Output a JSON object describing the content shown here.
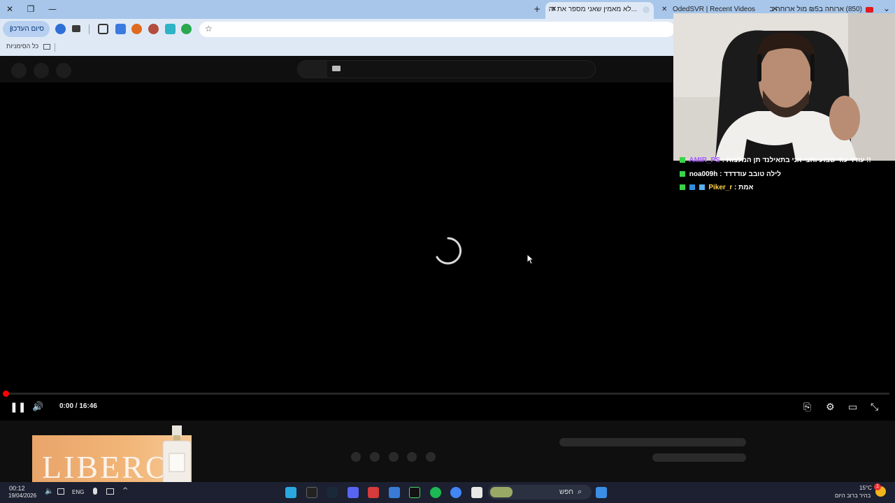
{
  "window": {
    "close_glyph": "✕",
    "restore_glyph": "❐",
    "minimize_glyph": "—",
    "new_tab_glyph": "+"
  },
  "tabs": [
    {
      "title": "...לא מאמין שאני מספר את זה",
      "close": "✕",
      "active": true,
      "icon": "audio-icon"
    },
    {
      "title": "OdedSVR | Recent Videos",
      "close": "✕",
      "active": false,
      "icon": "page-icon"
    },
    {
      "title": "(850) ארוחה ב₪5 מול ארוחה ב",
      "close": "✕",
      "active": false,
      "icon": "youtube-icon"
    }
  ],
  "tab_list_glyph": "⌄",
  "toolbar": {
    "session_button_label": "סיום העדכון",
    "session_menu_glyph": "⋮",
    "star_glyph": "☆"
  },
  "bookmarks": {
    "all_bookmarks_label": "כל הסימניות"
  },
  "player": {
    "time": "0:00 / 16:46",
    "progress_fraction": 0.0,
    "pause_glyph": "❚❚",
    "volume_glyph": "🔊",
    "captions_glyph": "⎘",
    "settings_glyph": "⚙",
    "theater_glyph": "▭",
    "fullscreen_glyph": "⤡"
  },
  "ad": {
    "brand_text": "LIBERO"
  },
  "chat": [
    {
      "user": "AMIR_PS",
      "message": "עודד עוד שבוע וחצי אני בתאילנד תן המלצות !!",
      "user_color": "#a259ff"
    },
    {
      "user": "noa009h",
      "message": "לילה טובב עודדדד",
      "user_color": "#ffffff"
    },
    {
      "user": "Piker_r",
      "message": "אמת",
      "user_color": "#ffd24a"
    }
  ],
  "taskbar": {
    "time": "00:12",
    "date": "19/04/2026",
    "language": "ENG",
    "search_label": "חפש",
    "weather_temp": "15°C",
    "weather_desc": "בהיר ברוב היום",
    "notification_count": "1"
  },
  "colors": {
    "tabbar": "#a7c6ea",
    "toolbar": "#dfe9f6",
    "progress_red": "#ff0000",
    "taskbar": "#1c2030"
  }
}
